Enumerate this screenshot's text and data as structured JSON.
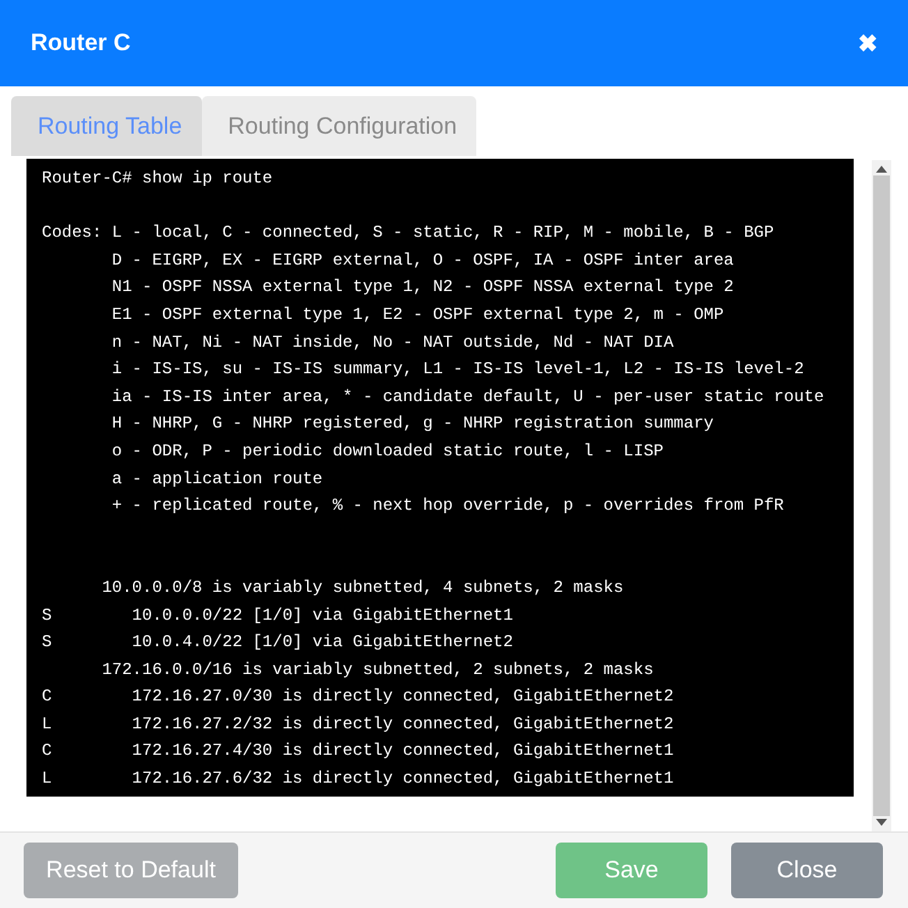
{
  "window": {
    "title": "Router C",
    "close": "✖"
  },
  "tabs": [
    {
      "label": "Routing Table",
      "selected": true
    },
    {
      "label": "Routing Configuration",
      "selected": false
    }
  ],
  "terminal": {
    "blocks": [
      [
        "Router-C# show ip route"
      ],
      [
        "Codes: L - local, C - connected, S - static, R - RIP, M - mobile, B - BGP",
        "       D - EIGRP, EX - EIGRP external, O - OSPF, IA - OSPF inter area",
        "       N1 - OSPF NSSA external type 1, N2 - OSPF NSSA external type 2",
        "       E1 - OSPF external type 1, E2 - OSPF external type 2, m - OMP",
        "       n - NAT, Ni - NAT inside, No - NAT outside, Nd - NAT DIA",
        "       i - IS-IS, su - IS-IS summary, L1 - IS-IS level-1, L2 - IS-IS level-2",
        "       ia - IS-IS inter area, * - candidate default, U - per-user static route",
        "       H - NHRP, G - NHRP registered, g - NHRP registration summary",
        "       o - ODR, P - periodic downloaded static route, l - LISP",
        "       a - application route",
        "       + - replicated route, % - next hop override, p - overrides from PfR"
      ],
      [
        "      10.0.0.0/8 is variably subnetted, 4 subnets, 2 masks",
        "S        10.0.0.0/22 [1/0] via GigabitEthernet1",
        "S        10.0.4.0/22 [1/0] via GigabitEthernet2",
        "      172.16.0.0/16 is variably subnetted, 2 subnets, 2 masks",
        "C        172.16.27.0/30 is directly connected, GigabitEthernet2",
        "L        172.16.27.2/32 is directly connected, GigabitEthernet2",
        "C        172.16.27.4/30 is directly connected, GigabitEthernet1",
        "L        172.16.27.6/32 is directly connected, GigabitEthernet1"
      ]
    ]
  },
  "buttons": [
    {
      "label": "Reset to Default",
      "kind": "reset"
    },
    {
      "label": "Save",
      "kind": "save"
    },
    {
      "label": "Close",
      "kind": "close"
    }
  ]
}
